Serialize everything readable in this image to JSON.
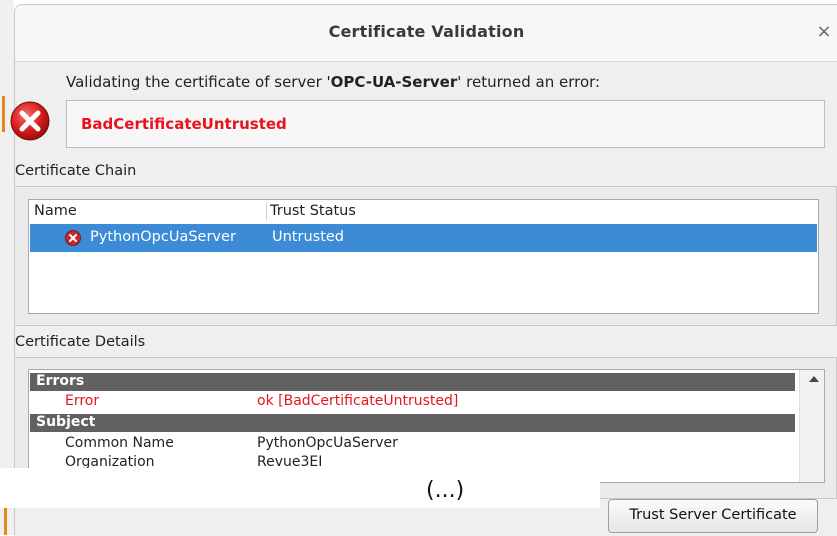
{
  "dialog": {
    "title": "Certificate Validation",
    "close_label": "×",
    "message_prefix": "Validating the certificate of server '",
    "server_name": "OPC-UA-Server",
    "message_suffix": "' returned an error:",
    "error_code": "BadCertificateUntrusted"
  },
  "chain": {
    "section_label": "Certificate Chain",
    "columns": [
      "Name",
      "Trust Status"
    ],
    "rows": [
      {
        "name": "PythonOpcUaServer",
        "status": "Untrusted",
        "icon": "error-icon"
      }
    ]
  },
  "details": {
    "section_label": "Certificate Details",
    "groups": [
      {
        "title": "Errors",
        "items": [
          {
            "key": "Error",
            "value": "ok [BadCertificateUntrusted]"
          }
        ]
      },
      {
        "title": "Subject",
        "items": [
          {
            "key": "Common Name",
            "value": "PythonOpcUaServer"
          },
          {
            "key": "Organization",
            "value": "Revue3EI"
          }
        ]
      }
    ]
  },
  "truncation_marker": "(...)",
  "buttons": {
    "trust": "Trust Server Certificate"
  },
  "colors": {
    "error": "#e8141d",
    "selection": "#3b8bd6",
    "group_header": "#616161"
  }
}
